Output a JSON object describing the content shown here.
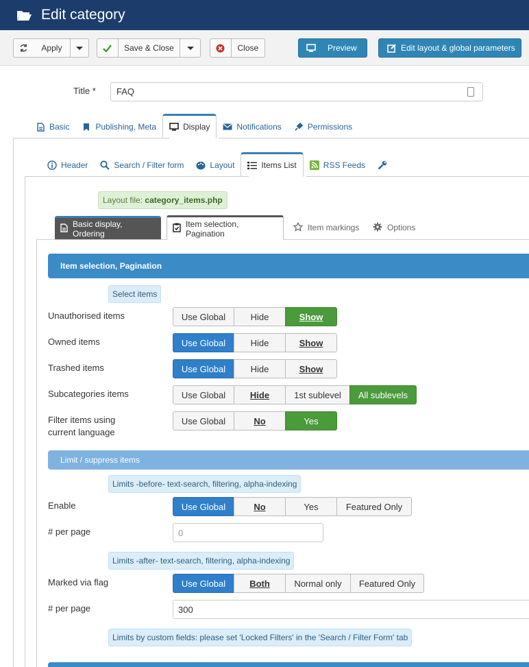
{
  "header": {
    "title": "Edit category",
    "icon": "folder-open-icon"
  },
  "toolbar": {
    "apply": "Apply",
    "save_close": "Save & Close",
    "close": "Close",
    "preview": "Preview",
    "edit_layout": "Edit layout & global parameters"
  },
  "form": {
    "title_label": "Title *",
    "title_value": "FAQ"
  },
  "main_tabs": [
    "Basic",
    "Publishing, Meta",
    "Display",
    "Notifications",
    "Permissions"
  ],
  "display_tabs": [
    "Header",
    "Search / Filter form",
    "Layout",
    "Items List",
    "RSS Feeds"
  ],
  "layout_file": {
    "prefix": "Layout file:",
    "name": "category_items.php"
  },
  "items_tabs": [
    "Basic display, Ordering",
    "Item selection, Pagination",
    "Item markings",
    "Options"
  ],
  "section": {
    "title": "Item selection, Pagination",
    "select_hint": "Select items",
    "rows": [
      {
        "label": "Unauthorised items",
        "options": [
          "Use Global",
          "Hide",
          "Show"
        ]
      },
      {
        "label": "Owned items",
        "options": [
          "Use Global",
          "Hide",
          "Show"
        ]
      },
      {
        "label": "Trashed items",
        "options": [
          "Use Global",
          "Hide",
          "Show"
        ]
      },
      {
        "label": "Subcategories items",
        "options": [
          "Use Global",
          "Hide",
          "1st sublevel",
          "All sublevels"
        ]
      },
      {
        "label_line1": "Filter items using",
        "label_line2": "current language",
        "options": [
          "Use Global",
          "No",
          "Yes"
        ]
      }
    ]
  },
  "limit": {
    "title": "Limit / suppress items",
    "before_hint": "Limits -before- text-search, filtering, alpha-indexing",
    "enable_label": "Enable",
    "enable_options": [
      "Use Global",
      "No",
      "Yes",
      "Featured Only"
    ],
    "per_page_label": "# per page",
    "per_page_before_placeholder": "0",
    "after_hint": "Limits -after- text-search, filtering, alpha-indexing",
    "marked_label": "Marked via flag",
    "marked_options": [
      "Use Global",
      "Both",
      "Normal only",
      "Featured Only"
    ],
    "per_page_after_value": "300",
    "custom_hint": "Limits by custom fields: please set 'Locked Filters' in the 'Search / Filter Form' tab"
  },
  "colors": {
    "header": "#1c3d6b",
    "section": "#3a8bc6",
    "active_blue": "#2f7fcb",
    "active_green": "#4b9a3b"
  }
}
